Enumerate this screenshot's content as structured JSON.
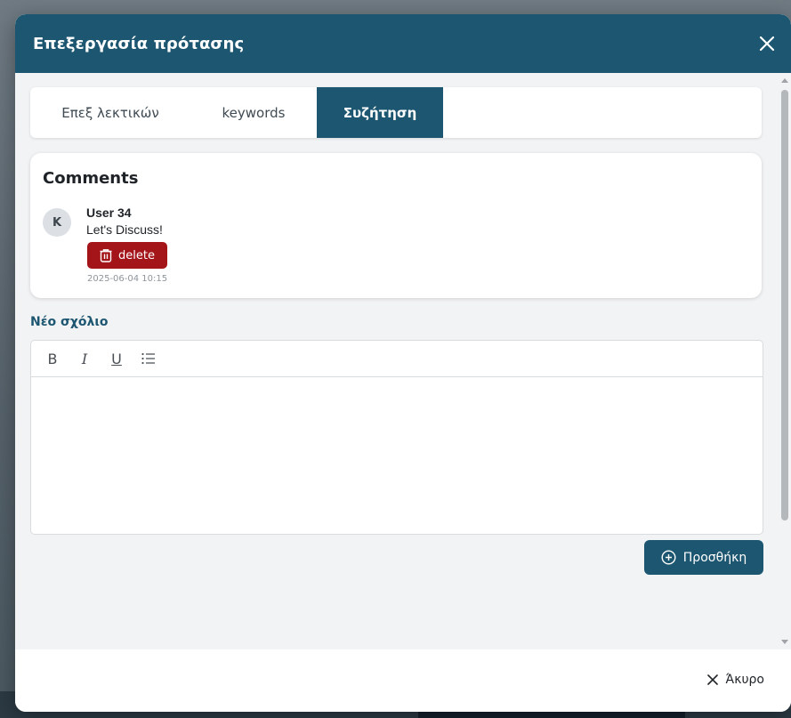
{
  "modal": {
    "title": "Επεξεργασία πρότασης"
  },
  "tabs": [
    {
      "label": "Επεξ λεκτικών"
    },
    {
      "label": "keywords"
    },
    {
      "label": "Συζήτηση",
      "active": true
    }
  ],
  "comments": {
    "title": "Comments",
    "items": [
      {
        "avatar_initial": "K",
        "user": "User 34",
        "text": "Let's Discuss!",
        "delete_label": "delete",
        "timestamp": "2025-06-04 10:15"
      }
    ]
  },
  "new_comment": {
    "label": "Νέο σχόλιο",
    "toolbar": {
      "bold": "B",
      "italic": "I",
      "underline": "U"
    },
    "value": ""
  },
  "add_button": {
    "label": "Προσθήκη"
  },
  "footer": {
    "cancel_label": "Άκυρο"
  },
  "colors": {
    "primary": "#1d5670",
    "danger": "#a31519",
    "background": "#f2f3f5"
  },
  "icons": {
    "close": "close-icon",
    "delete": "trash-icon",
    "add": "plus-circle-icon",
    "list": "bullet-list-icon",
    "cancel": "x-icon"
  }
}
